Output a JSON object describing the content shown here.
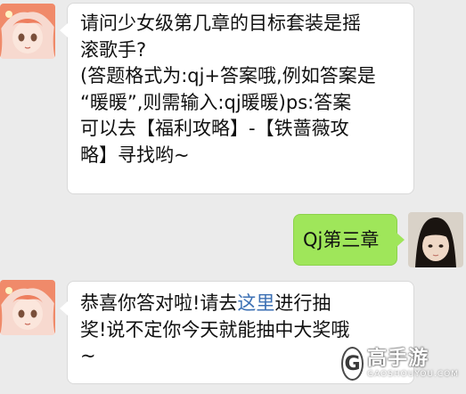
{
  "messages": [
    {
      "side": "left",
      "avatar": "anime-girl-avatar",
      "lines": [
        "请问少女级第几章的目标套装是摇",
        "滚歌手?",
        "(答题格式为:qj+答案哦,例如答案是",
        "“暖暖”,则需输入:qj暖暖)ps:答案",
        "可以去【福利攻略】-【铁蔷薇攻",
        "略】寻找哟~"
      ]
    },
    {
      "side": "right",
      "avatar": "user-photo-avatar",
      "lines": [
        "Qj第三章"
      ]
    },
    {
      "side": "left",
      "avatar": "anime-girl-avatar",
      "line1_before": "恭喜你答对啦!请去",
      "line1_link": "这里",
      "line1_after": "进行抽",
      "line2": "奖!说不定你今天就能抽中大奖哦",
      "line3": "~"
    }
  ],
  "watermark": {
    "logo_letter": "G",
    "name": "高手游",
    "domain": "GAOSHOUYOU.COM"
  },
  "colors": {
    "background": "#ebebeb",
    "incoming_bubble": "#ffffff",
    "outgoing_bubble": "#9fe65a",
    "link": "#3c70b4"
  }
}
